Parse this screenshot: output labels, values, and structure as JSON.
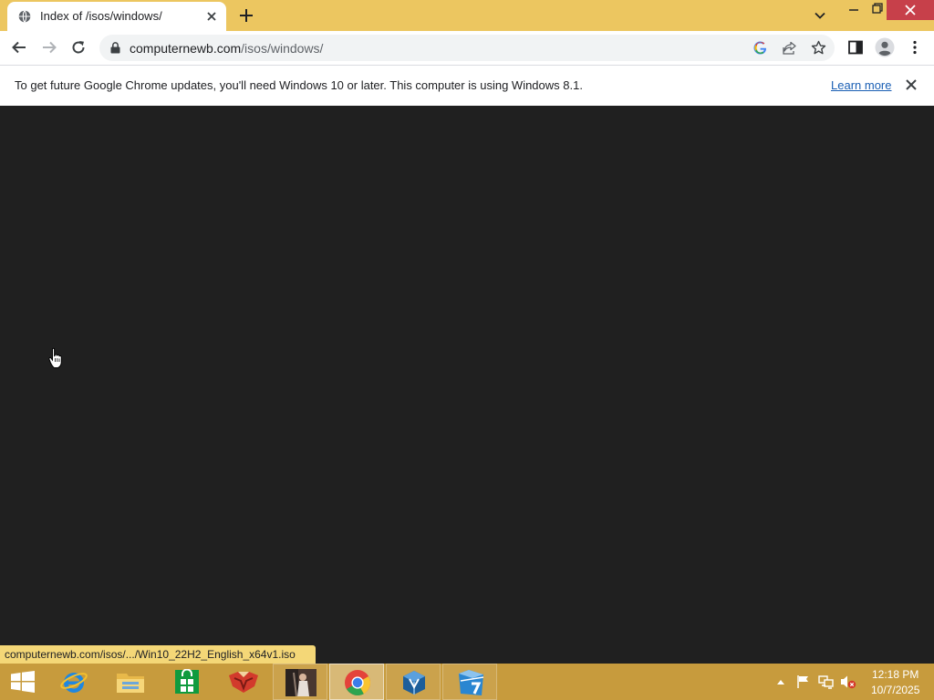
{
  "browser": {
    "tab": {
      "title": "Index of /isos/windows/"
    },
    "omnibox": {
      "host": "computernewb.com",
      "path": "/isos/windows/"
    }
  },
  "infobar": {
    "message": "To get future Google Chrome updates, you'll need Windows 10 or later. This computer is using Windows 8.1.",
    "link": "Learn more"
  },
  "status": {
    "link_preview": "computernewb.com/isos/.../Win10_22H2_English_x64v1.iso"
  },
  "taskbar": {
    "apps": [
      "start",
      "internet-explorer",
      "file-explorer",
      "store",
      "firefox-like",
      "photo",
      "chrome",
      "virtualbox",
      "7-zip"
    ],
    "clock": {
      "time": "12:18 PM",
      "date": "10/7/2025"
    }
  },
  "colors": {
    "tabstrip": "#ecc660",
    "content_background": "#202020",
    "taskbar": "#c79b3d",
    "close_button": "#c7404a",
    "link": "#1a5fb4"
  }
}
